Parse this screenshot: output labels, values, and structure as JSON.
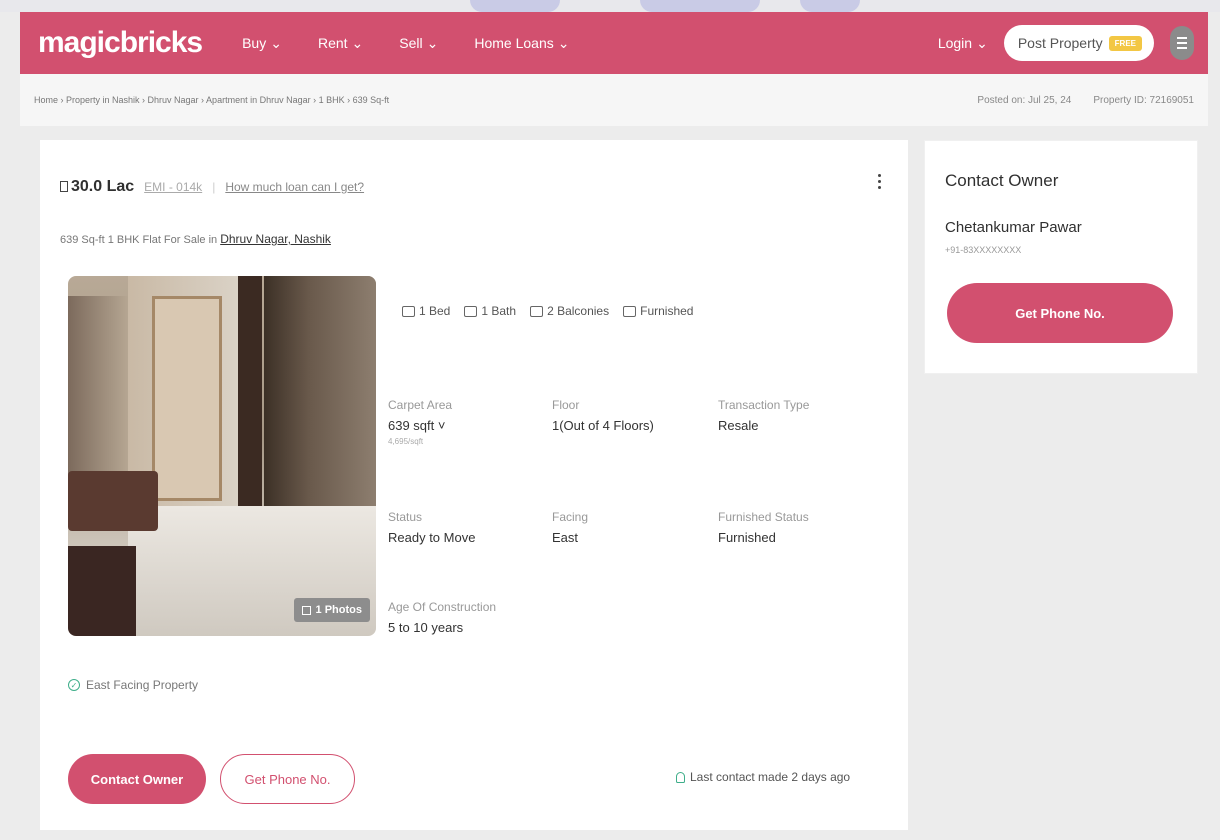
{
  "nav": {
    "logo": "magicbricks",
    "items": [
      {
        "label": "Buy",
        "caret": "⌄"
      },
      {
        "label": "Rent",
        "caret": "⌄"
      },
      {
        "label": "Sell",
        "caret": "⌄"
      },
      {
        "label": "Home Loans",
        "caret": "⌄"
      }
    ],
    "login": "Login",
    "post_property": "Post Property",
    "free_badge": "FREE"
  },
  "breadcrumb": {
    "path": "Home › Property in Nashik › Dhruv Nagar › Apartment in Dhruv Nagar › 1 BHK › 639 Sq-ft",
    "posted_on": "Posted on: Jul 25, 24",
    "property_id": "Property ID: 72169051"
  },
  "listing": {
    "price": "30.0 Lac",
    "emi": "EMI - 014k",
    "separator": "|",
    "loan_link": "How much loan can I get?",
    "subtitle_prefix": "639 Sq-ft 1 BHK Flat For Sale in",
    "location_link": "Dhruv Nagar, Nashik",
    "photos_badge": "1 Photos",
    "amenities": [
      {
        "icon": "bed-icon",
        "label": "1 Bed"
      },
      {
        "icon": "bath-icon",
        "label": "1 Bath"
      },
      {
        "icon": "balcony-icon",
        "label": "2 Balconies"
      },
      {
        "icon": "furnished-icon",
        "label": "Furnished"
      }
    ],
    "summary": {
      "carpet_area": {
        "label": "Carpet Area",
        "value": "639 sqft",
        "sub": "4,695/sqft"
      },
      "floor": {
        "label": "Floor",
        "value": "1(Out of 4 Floors)"
      },
      "transaction": {
        "label": "Transaction Type",
        "value": "Resale"
      },
      "status": {
        "label": "Status",
        "value": "Ready to Move"
      },
      "facing": {
        "label": "Facing",
        "value": "East"
      },
      "furnished": {
        "label": "Furnished Status",
        "value": "Furnished"
      },
      "age": {
        "label": "Age Of Construction",
        "value": "5 to 10 years"
      }
    },
    "facing_note": "East Facing Property",
    "contact_button": "Contact Owner",
    "phone_button": "Get Phone No.",
    "last_contact": "Last contact made 2 days ago"
  },
  "owner": {
    "title": "Contact Owner",
    "name": "Chetankumar Pawar",
    "phone": "+91-83XXXXXXXX",
    "button": "Get Phone No."
  },
  "colors": {
    "brand": "#d2506f",
    "accent_green": "#3fae8a",
    "badge_yellow": "#f3c744"
  }
}
